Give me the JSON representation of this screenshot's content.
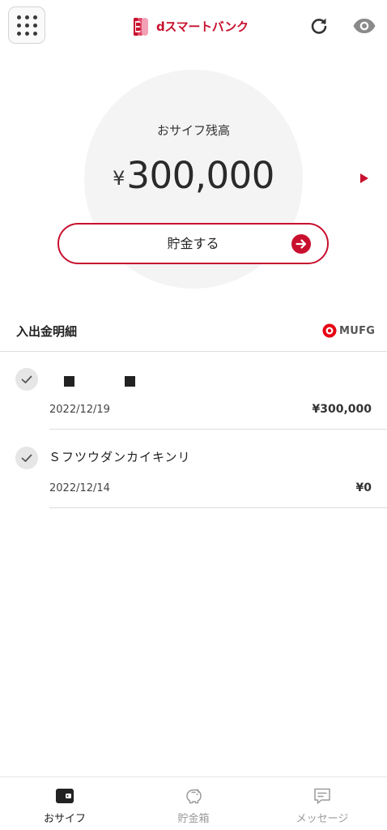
{
  "header": {
    "logo_text": "dスマートバンク",
    "menu_icon": "grid-menu-icon",
    "refresh_icon": "refresh-icon",
    "visibility_icon": "eye-icon"
  },
  "balance": {
    "label": "おサイフ残高",
    "currency": "¥",
    "amount": "300,000"
  },
  "save_button": {
    "label": "貯金する"
  },
  "transactions": {
    "title": "入出金明細",
    "bank_logo": "MUFG",
    "items": [
      {
        "name": "",
        "date": "2022/12/19",
        "amount": "¥300,000",
        "status_icon": "check-icon"
      },
      {
        "name": "Ｓフツウダンカイキンリ",
        "date": "2022/12/14",
        "amount": "¥0",
        "status_icon": "check-icon"
      }
    ]
  },
  "bottom_nav": {
    "items": [
      {
        "label": "おサイフ",
        "icon": "wallet-icon",
        "active": true
      },
      {
        "label": "貯金箱",
        "icon": "piggy-bank-icon",
        "active": false
      },
      {
        "label": "メッセージ",
        "icon": "message-icon",
        "active": false
      }
    ]
  },
  "colors": {
    "brand": "#c8102e",
    "text": "#222222",
    "muted": "#9a9a9a",
    "circle_bg": "#f4f4f4"
  }
}
